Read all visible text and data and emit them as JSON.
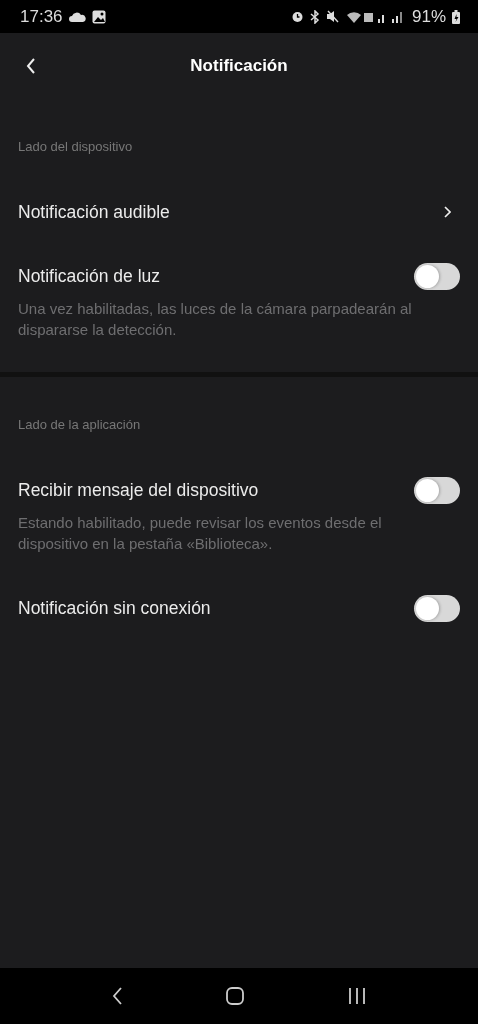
{
  "status_bar": {
    "time": "17:36",
    "battery": "91%"
  },
  "header": {
    "title": "Notificación"
  },
  "sections": [
    {
      "label": "Lado del dispositivo",
      "items": [
        {
          "kind": "link",
          "label": "Notificación audible"
        },
        {
          "kind": "toggle",
          "label": "Notificación de luz",
          "on": false,
          "description": "Una vez habilitadas, las luces de la cámara parpadearán al dispararse la detección."
        }
      ]
    },
    {
      "label": "Lado de la aplicación",
      "items": [
        {
          "kind": "toggle",
          "label": "Recibir mensaje del dispositivo",
          "on": false,
          "description": "Estando habilitado, puede revisar los eventos desde el dispositivo en la pestaña «Biblioteca»."
        },
        {
          "kind": "toggle",
          "label": "Notificación sin conexión",
          "on": false
        }
      ]
    }
  ]
}
